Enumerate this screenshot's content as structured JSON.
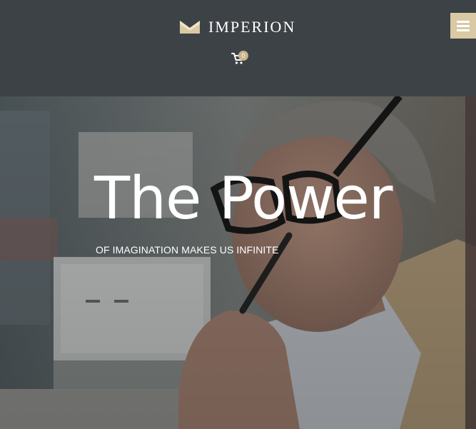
{
  "header": {
    "brand": "IMPERION",
    "cart_count": "0",
    "background_color": "#3d4246",
    "accent_color": "#d9c9a4"
  },
  "icons": {
    "logo": "crown-icon",
    "cart": "shopping-cart-icon",
    "menu": "hamburger-menu-icon"
  },
  "hero": {
    "title": "The Power",
    "subtitle": "OF IMAGINATION MAKES US INFINITE"
  }
}
